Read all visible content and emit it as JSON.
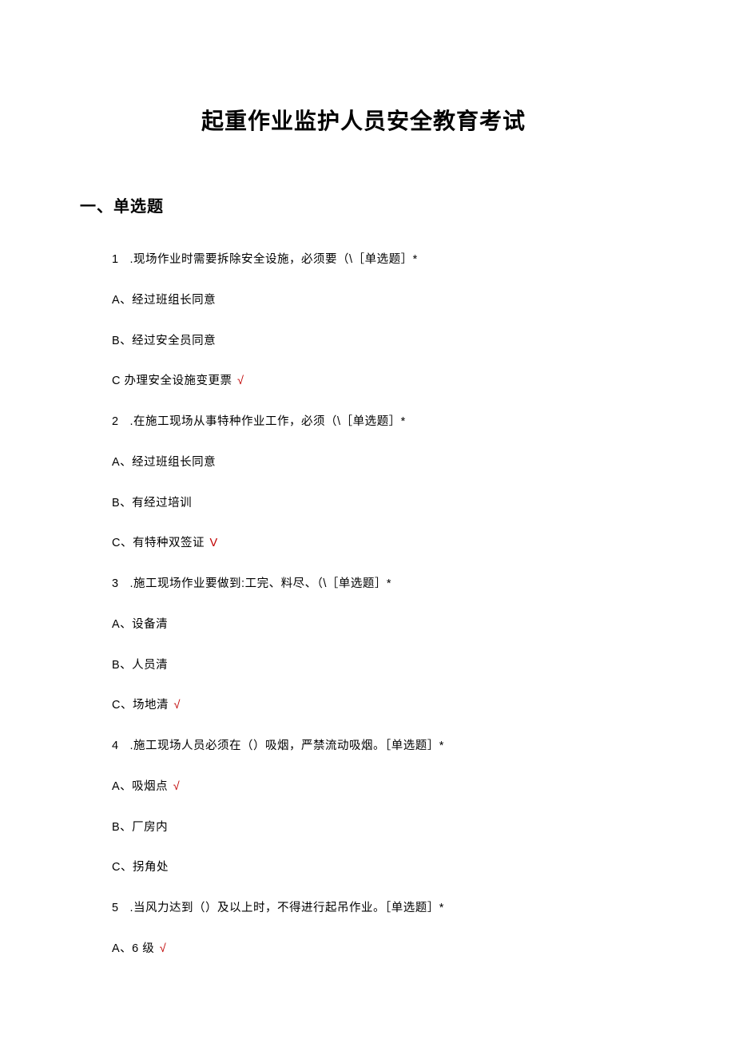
{
  "title": "起重作业监护人员安全教育考试",
  "section_heading": "一、单选题",
  "questions": [
    {
      "num": "1",
      "text": " .现场作业时需要拆除安全设施，必须要（\\［单选题］*",
      "options": [
        {
          "label": "A、经过班组长同意",
          "mark": ""
        },
        {
          "label": "B、经过安全员同意",
          "mark": ""
        },
        {
          "label": "C 办理安全设施变更票",
          "mark": " √",
          "mark_class": "check"
        }
      ]
    },
    {
      "num": "2",
      "text": " .在施工现场从事特种作业工作，必须（\\［单选题］*",
      "options": [
        {
          "label": "A、经过班组长同意",
          "mark": ""
        },
        {
          "label": "B、有经过培训",
          "mark": ""
        },
        {
          "label": "C、有特种双签证",
          "mark": " V",
          "mark_class": "check-v"
        }
      ]
    },
    {
      "num": "3",
      "text": " .施工现场作业要做到:工完、料尽、（\\［单选题］*",
      "options": [
        {
          "label": "A、设备清",
          "mark": ""
        },
        {
          "label": "B、人员清",
          "mark": ""
        },
        {
          "label": "C、场地清",
          "mark": " √",
          "mark_class": "check"
        }
      ]
    },
    {
      "num": "4",
      "text": " .施工现场人员必须在（）吸烟，严禁流动吸烟。［单选题］*",
      "options": [
        {
          "label": "A、吸烟点",
          "mark": " √",
          "mark_class": "check"
        },
        {
          "label": "B、厂房内",
          "mark": ""
        },
        {
          "label": "C、拐角处",
          "mark": ""
        }
      ]
    },
    {
      "num": "5",
      "text": " .当风力达到（）及以上时，不得进行起吊作业。［单选题］*",
      "options": [
        {
          "label": "A、6 级",
          "mark": " √",
          "mark_class": "check"
        }
      ]
    }
  ]
}
